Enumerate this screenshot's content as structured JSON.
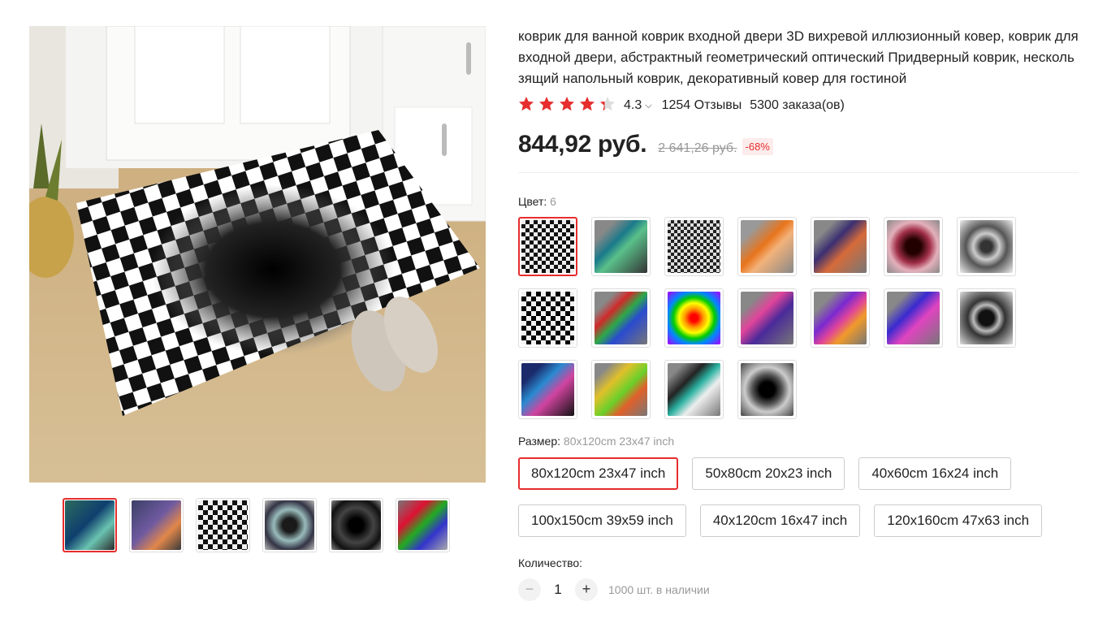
{
  "product": {
    "title": "коврик для ванной коврик входной двери 3D вихревой иллюзионный ковер, коврик для входной двери, абстрактный геометрический оптический Придверный коврик, нескользящий напольный коврик, декоративный ковер для гостиной",
    "rating": "4.3",
    "rating_value": 4.3,
    "reviews": "1254 Отзывы",
    "orders": "5300 заказа(ов)",
    "price": "844,92 руб.",
    "old_price": "2 641,26 руб.",
    "discount": "-68%"
  },
  "color": {
    "label": "Цвет:",
    "selected_value": "6",
    "selected_index": 0,
    "count": 18
  },
  "size": {
    "label": "Размер:",
    "selected_value": "80x120cm 23x47 inch",
    "options": [
      "80x120cm 23x47 inch",
      "50x80cm 20x23 inch",
      "40x60cm 16x24 inch",
      "100x150cm 39x59 inch",
      "40x120cm 16x47 inch",
      "120x160cm 47x63 inch"
    ],
    "selected_index": 0
  },
  "quantity": {
    "label": "Количество:",
    "value": "1",
    "minus": "−",
    "plus": "+",
    "stock": "1000 шт. в наличии"
  },
  "gallery": {
    "thumb_count": 6,
    "selected_index": 0
  },
  "colors": {
    "accent": "#e62e2e",
    "star": "#e62e2e"
  }
}
